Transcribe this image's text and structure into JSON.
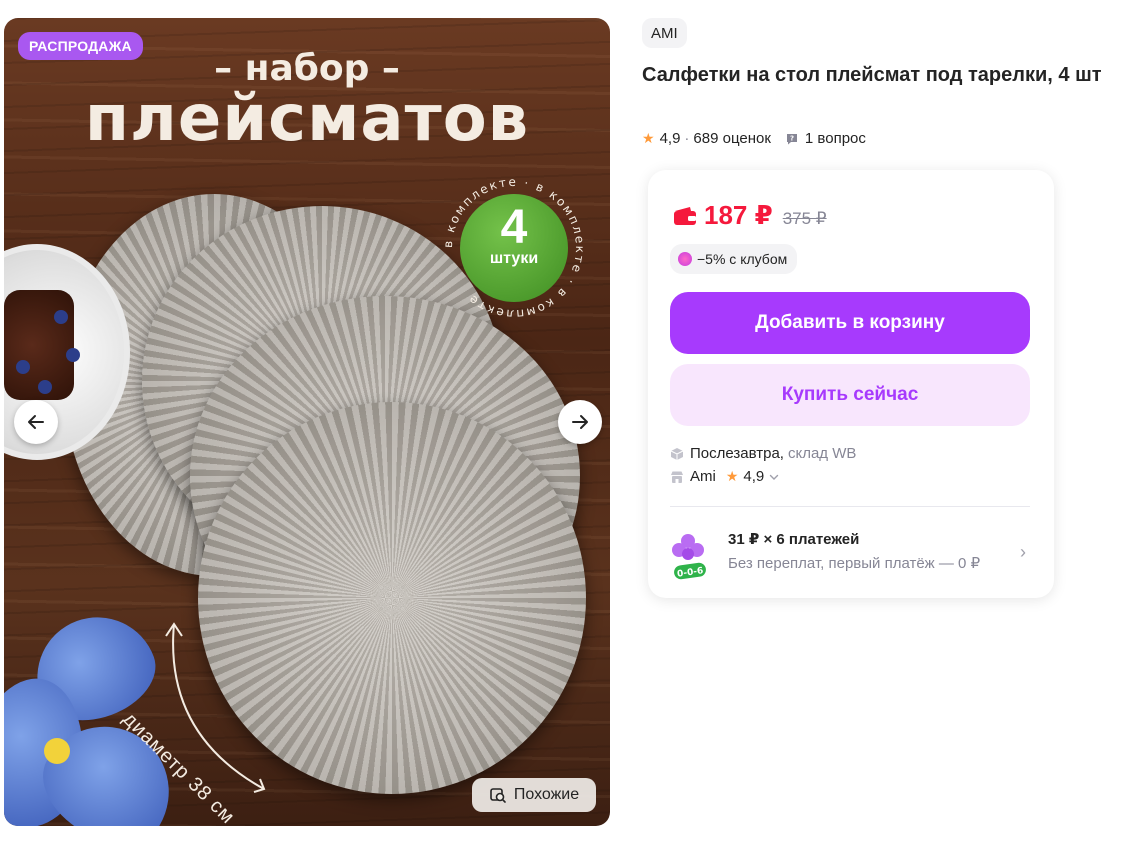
{
  "gallery": {
    "sale_badge": "РАСПРОДАЖА",
    "promo_subtitle": "– набор –",
    "promo_title": "плейсматов",
    "count_number": "4",
    "count_unit": "штуки",
    "ring_text": "в комплекте · в комплекте · в комплекте",
    "diameter_label": "диаметр 38 см",
    "similar_label": "Похожие",
    "icons": {
      "prev": "arrow-left-icon",
      "next": "arrow-right-icon",
      "similar": "similar-search-icon"
    }
  },
  "product": {
    "brand": "AMI",
    "title": "Салфетки на стол плейсмат под тарелки, 4 шт",
    "rating": "4,9",
    "reviews": "689 оценок",
    "questions": "1 вопрос"
  },
  "buy_card": {
    "price_now": "187 ₽",
    "price_old": "375 ₽",
    "club_discount": "−5% с клубом",
    "add_to_cart": "Добавить в корзину",
    "buy_now": "Купить сейчас",
    "delivery_day": "Послезавтра,",
    "delivery_stock": "склад WB",
    "seller_name": "Ami",
    "seller_rating": "4,9",
    "installment_title": "31 ₽ × 6 платежей",
    "installment_sub": "Без переплат, первый платёж — 0 ₽",
    "installment_badge": "0-0-6"
  },
  "colors": {
    "accent": "#a73afd",
    "accent_light": "#f8e6fd",
    "price": "#f5193c",
    "star": "#ff9a3a",
    "sale_badge": "#a958f0",
    "muted": "#868695"
  }
}
